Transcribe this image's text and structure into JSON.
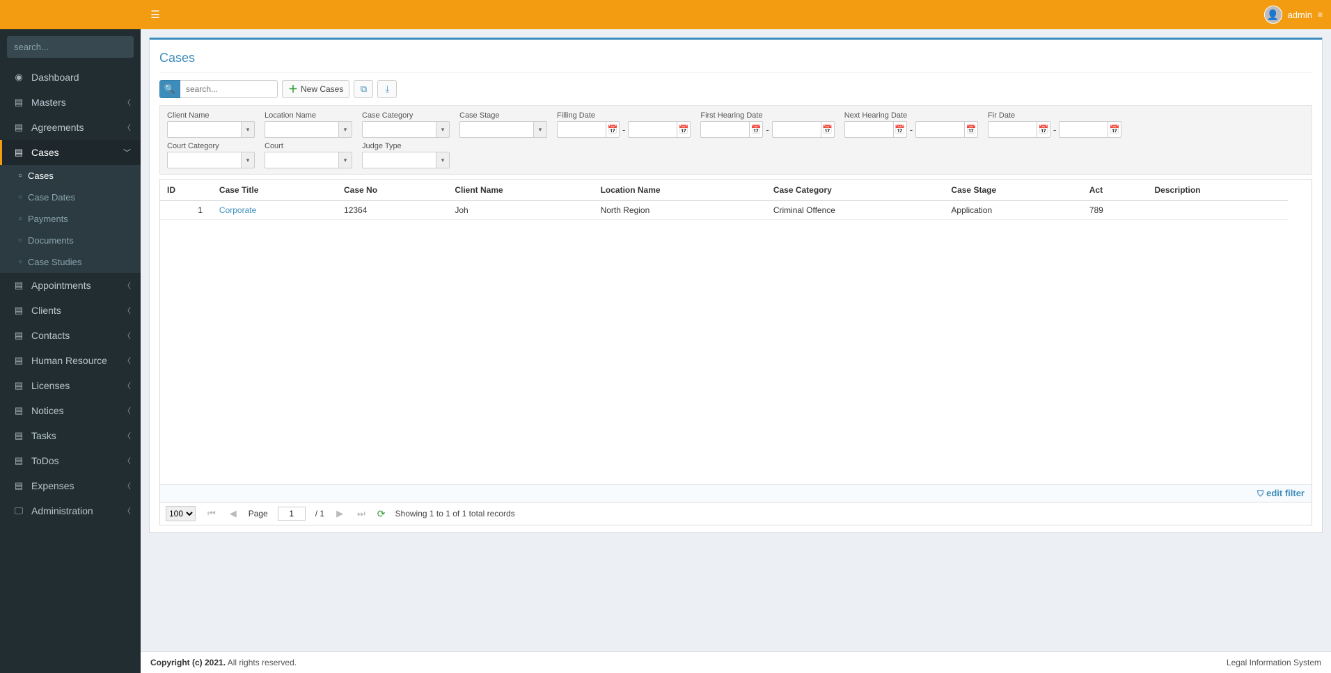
{
  "header": {
    "user_label": "admin"
  },
  "sidebar": {
    "search_placeholder": "search...",
    "items": [
      {
        "icon": "◉",
        "label": "Dashboard",
        "expandable": false
      },
      {
        "icon": "▤",
        "label": "Masters",
        "expandable": true
      },
      {
        "icon": "▤",
        "label": "Agreements",
        "expandable": true
      },
      {
        "icon": "▤",
        "label": "Cases",
        "expandable": true,
        "active": true,
        "children": [
          {
            "label": "Cases",
            "active": true
          },
          {
            "label": "Case Dates"
          },
          {
            "label": "Payments"
          },
          {
            "label": "Documents"
          },
          {
            "label": "Case Studies"
          }
        ]
      },
      {
        "icon": "▤",
        "label": "Appointments",
        "expandable": true
      },
      {
        "icon": "▤",
        "label": "Clients",
        "expandable": true
      },
      {
        "icon": "▤",
        "label": "Contacts",
        "expandable": true
      },
      {
        "icon": "▤",
        "label": "Human Resource",
        "expandable": true
      },
      {
        "icon": "▤",
        "label": "Licenses",
        "expandable": true
      },
      {
        "icon": "▤",
        "label": "Notices",
        "expandable": true
      },
      {
        "icon": "▤",
        "label": "Tasks",
        "expandable": true
      },
      {
        "icon": "▤",
        "label": "ToDos",
        "expandable": true
      },
      {
        "icon": "▤",
        "label": "Expenses",
        "expandable": true
      },
      {
        "icon": "🖵",
        "label": "Administration",
        "expandable": true
      }
    ]
  },
  "page": {
    "title": "Cases",
    "search_placeholder": "search...",
    "new_button": "New Cases",
    "edit_filter": "edit filter"
  },
  "filters": {
    "row1": [
      {
        "label": "Client Name",
        "type": "select"
      },
      {
        "label": "Location Name",
        "type": "select"
      },
      {
        "label": "Case Category",
        "type": "select"
      },
      {
        "label": "Case Stage",
        "type": "select"
      },
      {
        "label": "Filling Date",
        "type": "daterange"
      },
      {
        "label": "First Hearing Date",
        "type": "daterange"
      },
      {
        "label": "Next Hearing Date",
        "type": "daterange"
      },
      {
        "label": "Fir Date",
        "type": "daterange"
      }
    ],
    "row2": [
      {
        "label": "Court Category",
        "type": "select"
      },
      {
        "label": "Court",
        "type": "select"
      },
      {
        "label": "Judge Type",
        "type": "select"
      }
    ]
  },
  "table": {
    "columns": [
      "ID",
      "Case Title",
      "Case No",
      "Client Name",
      "Location Name",
      "Case Category",
      "Case Stage",
      "Act",
      "Description"
    ],
    "rows": [
      {
        "ID": "1",
        "Case Title": "Corporate",
        "Case No": "12364",
        "Client Name": "Joh",
        "Location Name": "North Region",
        "Case Category": "Criminal Offence",
        "Case Stage": "Application",
        "Act": "789",
        "Description": ""
      }
    ]
  },
  "pager": {
    "page_size": "100",
    "page_label": "Page",
    "page_current": "1",
    "page_total": "/ 1",
    "info": "Showing 1 to 1 of 1 total records"
  },
  "footer": {
    "left_bold": "Copyright (c) 2021.",
    "left_rest": " All rights reserved.",
    "right": "Legal Information System"
  }
}
